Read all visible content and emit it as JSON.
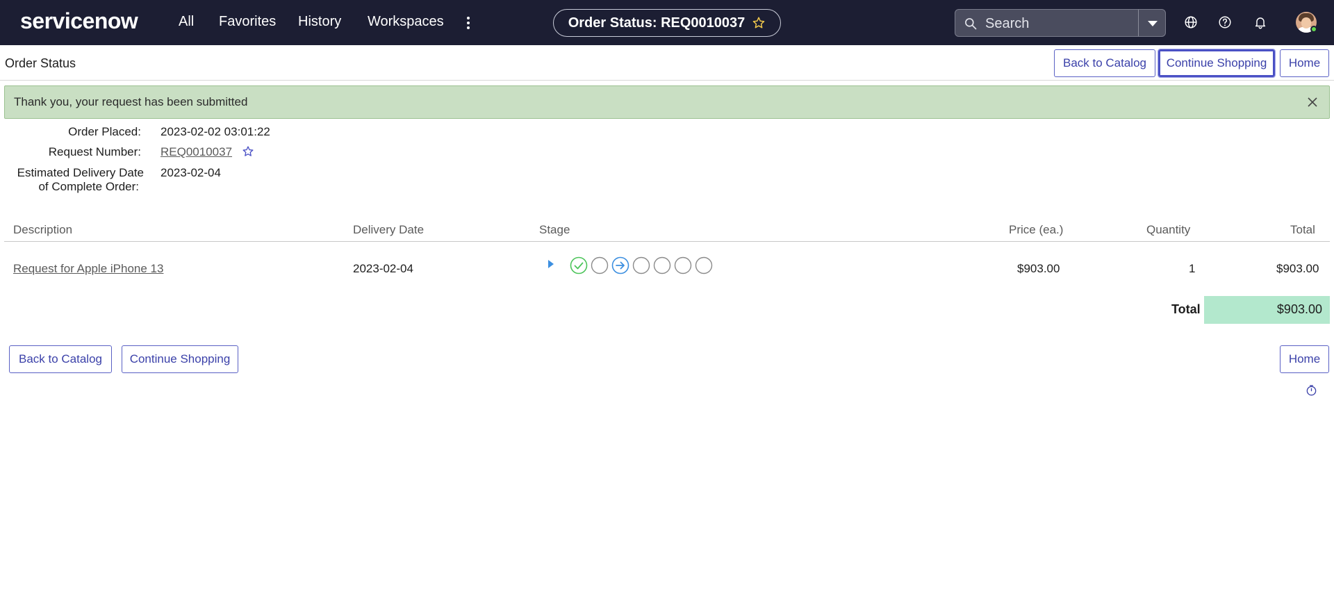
{
  "topbar": {
    "logo": "servicenow",
    "nav": [
      "All",
      "Favorites",
      "History",
      "Workspaces"
    ],
    "page_title": "Order Status: REQ0010037",
    "search_placeholder": "Search"
  },
  "header": {
    "heading": "Order Status",
    "back_to_catalog": "Back to Catalog",
    "continue_shopping": "Continue Shopping",
    "home": "Home"
  },
  "alert": {
    "message": "Thank you, your request has been submitted"
  },
  "order": {
    "placed_label": "Order Placed:",
    "placed_value": "2023-02-02 03:01:22",
    "request_label": "Request Number:",
    "request_value": "REQ0010037",
    "delivery_label_line1": "Estimated Delivery Date",
    "delivery_label_line2": "of Complete Order:",
    "delivery_value": "2023-02-04"
  },
  "table": {
    "headers": {
      "description": "Description",
      "delivery_date": "Delivery Date",
      "stage": "Stage",
      "price": "Price (ea.)",
      "quantity": "Quantity",
      "total": "Total"
    },
    "rows": [
      {
        "description": "Request for Apple iPhone 13",
        "delivery_date": "2023-02-04",
        "stages": [
          "completed",
          "pending",
          "in-progress",
          "pending",
          "pending",
          "pending",
          "pending"
        ],
        "price": "$903.00",
        "quantity": "1",
        "total": "$903.00"
      }
    ],
    "total_label": "Total",
    "total_value": "$903.00"
  },
  "footer": {
    "back_to_catalog": "Back to Catalog",
    "continue_shopping": "Continue Shopping",
    "home": "Home"
  },
  "colors": {
    "topbar_bg": "#1c1e33",
    "accent": "#3b41a9",
    "alert_bg": "#c9dfc3",
    "total_bg": "#b3e8cd",
    "stage_complete": "#4cc45a",
    "stage_active": "#3c8fe0"
  }
}
